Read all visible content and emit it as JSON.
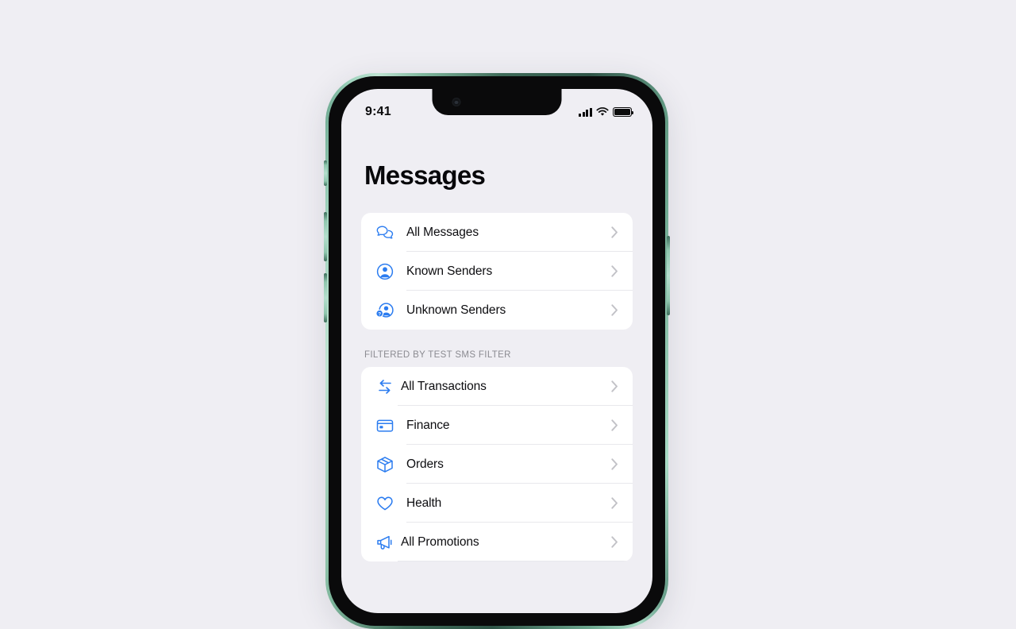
{
  "colors": {
    "page_background": "#efeef3",
    "screen_background": "#efeef3",
    "card": "#ffffff",
    "accent_blue": "#2b7cf0",
    "title_text": "#07070a",
    "row_text": "#0d0d10",
    "section_header_text": "#8b8b91",
    "chevron": "#c2c2c7",
    "separator": "#e8e8ec",
    "bezel": "#0a0a0b",
    "frame_metal": "#8fc6ae"
  },
  "device": {
    "name": "iphone-mockup",
    "side_buttons": [
      "mute-switch",
      "volume-up",
      "volume-down",
      "power-button"
    ]
  },
  "status_bar": {
    "time": "9:41",
    "signal_icon": "signal-bars-icon",
    "signal_bars": 4,
    "wifi_icon": "wifi-icon",
    "battery_icon": "battery-icon",
    "battery_level": "full"
  },
  "screen": {
    "title": "Messages",
    "groups": [
      {
        "id": "senders",
        "header": null,
        "rows": [
          {
            "label": "All Messages",
            "icon": "two-speech-bubbles-icon",
            "separator": "inset"
          },
          {
            "label": "Known Senders",
            "icon": "person-circle-icon",
            "separator": "inset"
          },
          {
            "label": "Unknown Senders",
            "icon": "person-question-icon",
            "separator": "none"
          }
        ]
      },
      {
        "id": "filtered",
        "header": "Filtered by Test SMS Filter",
        "rows": [
          {
            "label": "All Transactions",
            "icon": "exchange-arrows-icon",
            "separator": "inset"
          },
          {
            "label": "Finance",
            "icon": "credit-card-icon",
            "separator": "inset"
          },
          {
            "label": "Orders",
            "icon": "package-box-icon",
            "separator": "inset"
          },
          {
            "label": "Health",
            "icon": "heart-icon",
            "separator": "inset"
          },
          {
            "label": "All Promotions",
            "icon": "megaphone-icon",
            "separator": "full"
          }
        ]
      }
    ],
    "chevron_icon": "chevron-right-icon"
  }
}
